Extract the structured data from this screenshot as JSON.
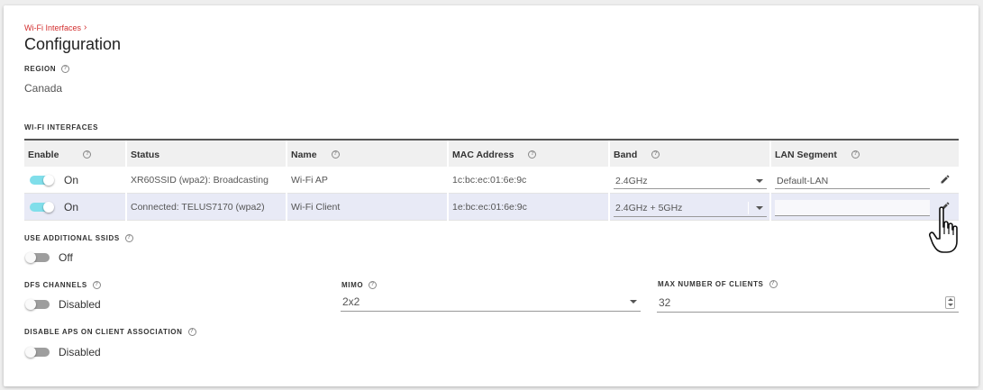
{
  "breadcrumb": {
    "label": "Wi-Fi Interfaces",
    "chevron": "›"
  },
  "page_title": "Configuration",
  "region": {
    "label": "REGION",
    "value": "Canada"
  },
  "wifi_interfaces": {
    "label": "WI-FI INTERFACES",
    "columns": [
      "Enable",
      "Status",
      "Name",
      "MAC Address",
      "Band",
      "LAN Segment"
    ],
    "rows": [
      {
        "enabled": true,
        "enable_text": "On",
        "status": "XR60SSID (wpa2): Broadcasting",
        "name": "Wi-Fi AP",
        "mac": "1c:bc:ec:01:6e:9c",
        "band": "2.4GHz",
        "lan_segment": "Default-LAN"
      },
      {
        "enabled": true,
        "enable_text": "On",
        "status": "Connected: TELUS7170 (wpa2)",
        "name": "Wi-Fi Client",
        "mac": "1e:bc:ec:01:6e:9c",
        "band": "2.4GHz + 5GHz",
        "lan_segment": ""
      }
    ]
  },
  "additional_ssids": {
    "label": "USE ADDITIONAL SSIDS",
    "value": "Off"
  },
  "dfs_channels": {
    "label": "DFS CHANNELS",
    "value": "Disabled"
  },
  "mimo": {
    "label": "MIMO",
    "value": "2x2"
  },
  "max_clients": {
    "label": "MAX NUMBER OF CLIENTS",
    "value": "32"
  },
  "disable_aps": {
    "label": "DISABLE APS ON CLIENT ASSOCIATION",
    "value": "Disabled"
  },
  "icons": {
    "help": "help-circle-icon",
    "edit": "pencil-icon",
    "cursor": "hand-pointer-icon"
  },
  "colors": {
    "accent": "#d32f2f",
    "toggle_on": "#80deea",
    "row_highlight": "#e8eaf6"
  }
}
